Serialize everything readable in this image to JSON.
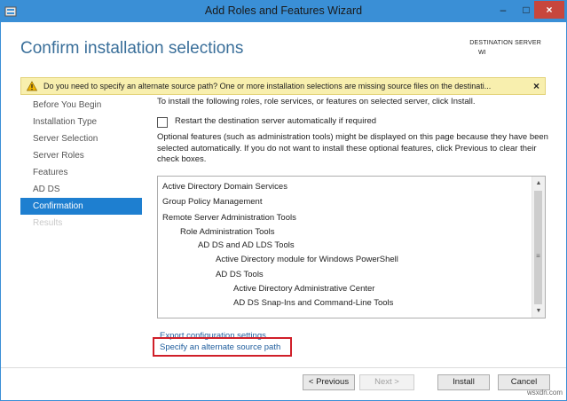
{
  "window": {
    "title": "Add Roles and Features Wizard",
    "close_symbol": "×",
    "minimize_symbol": "–",
    "maximize_symbol": "□"
  },
  "header": {
    "page_title": "Confirm installation selections",
    "destination_label": "DESTINATION SERVER",
    "destination_value": "WI"
  },
  "warning": {
    "icon": "warning-icon",
    "text": "Do you need to specify an alternate source path? One or more installation selections are missing source files on the destinati...",
    "close_symbol": "×"
  },
  "nav": {
    "items": [
      {
        "label": "Before You Begin",
        "state": "normal"
      },
      {
        "label": "Installation Type",
        "state": "normal"
      },
      {
        "label": "Server Selection",
        "state": "normal"
      },
      {
        "label": "Server Roles",
        "state": "normal"
      },
      {
        "label": "Features",
        "state": "normal"
      },
      {
        "label": "AD DS",
        "state": "normal"
      },
      {
        "label": "Confirmation",
        "state": "active"
      },
      {
        "label": "Results",
        "state": "disabled"
      }
    ]
  },
  "content": {
    "intro": "To install the following roles, role services, or features on selected server, click Install.",
    "restart_label": "Restart the destination server automatically if required",
    "restart_checked": false,
    "optional_text": "Optional features (such as administration tools) might be displayed on this page because they have been selected automatically. If you do not want to install these optional features, click Previous to clear their check boxes.",
    "selections": [
      {
        "label": "Active Directory Domain Services",
        "level": 0
      },
      {
        "label": "Group Policy Management",
        "level": 0
      },
      {
        "label": "Remote Server Administration Tools",
        "level": 0
      },
      {
        "label": "Role Administration Tools",
        "level": 1
      },
      {
        "label": "AD DS and AD LDS Tools",
        "level": 2
      },
      {
        "label": "Active Directory module for Windows PowerShell",
        "level": 3
      },
      {
        "label": "AD DS Tools",
        "level": 3
      },
      {
        "label": "Active Directory Administrative Center",
        "level": 4
      },
      {
        "label": "AD DS Snap-Ins and Command-Line Tools",
        "level": 4
      }
    ],
    "export_link": "Export configuration settings",
    "alternate_source_link": "Specify an alternate source path"
  },
  "footer": {
    "previous_label": "< Previous",
    "next_label": "Next >",
    "install_label": "Install",
    "cancel_label": "Cancel",
    "watermark": "wsxdn.com"
  },
  "colors": {
    "title_bar": "#3a8fd6",
    "accent": "#1e7fd0",
    "warning_bg": "#f8efae",
    "highlight_border": "#d01f29",
    "link": "#1e5c9c"
  }
}
